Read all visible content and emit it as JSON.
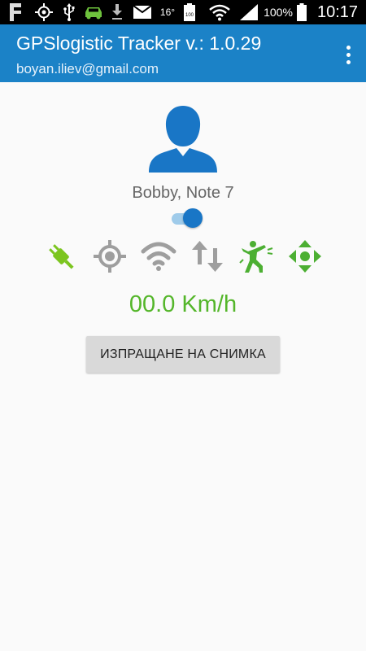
{
  "status_bar": {
    "temperature": "16°",
    "battery_small": "100",
    "battery_percent": "100%",
    "time": "10:17",
    "icons": [
      "f-app-icon",
      "gps-icon",
      "usb-icon",
      "car-icon",
      "download-icon",
      "mail-icon",
      "battery-100-icon",
      "wifi-icon",
      "signal-icon",
      "battery-icon"
    ]
  },
  "app_bar": {
    "title": "GPSlogistic Tracker v.: 1.0.29",
    "subtitle": "boyan.iliev@gmail.com",
    "menu_icon": "more-vert-icon",
    "color": "#1b82c7"
  },
  "profile": {
    "avatar_icon": "user-silhouette-icon",
    "name": "Bobby, Note 7",
    "tracking_enabled": true
  },
  "status_icons": [
    {
      "name": "power-plug-icon",
      "color": "#7cc520"
    },
    {
      "name": "gps-target-icon",
      "color": "#9e9e9e"
    },
    {
      "name": "wifi-icon",
      "color": "#9e9e9e"
    },
    {
      "name": "data-transfer-icon",
      "color": "#9e9e9e"
    },
    {
      "name": "shake-person-icon",
      "color": "#4caf32"
    },
    {
      "name": "move-arrows-icon",
      "color": "#4caf32"
    }
  ],
  "speed": "00.0 Km/h",
  "send_photo_button": "ИЗПРАЩАНЕ НА СНИМКА",
  "colors": {
    "accent": "#1976c6",
    "speed_green": "#54b62a",
    "background": "#fafafa"
  }
}
